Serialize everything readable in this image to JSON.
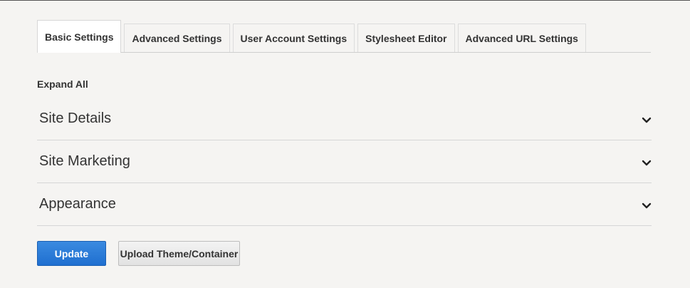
{
  "tabs": [
    {
      "label": "Basic Settings",
      "active": true
    },
    {
      "label": "Advanced Settings",
      "active": false
    },
    {
      "label": "User Account Settings",
      "active": false
    },
    {
      "label": "Stylesheet Editor",
      "active": false
    },
    {
      "label": "Advanced URL Settings",
      "active": false
    }
  ],
  "expand_all_label": "Expand All",
  "sections": [
    {
      "title": "Site Details",
      "icon": "chevron-down-icon"
    },
    {
      "title": "Site Marketing",
      "icon": "chevron-down-icon"
    },
    {
      "title": "Appearance",
      "icon": "chevron-down-icon"
    }
  ],
  "buttons": {
    "update_label": "Update",
    "upload_label": "Upload Theme/Container"
  },
  "colors": {
    "background": "#f5f4f2",
    "primary_button": "#2a7ad8",
    "text": "#333333"
  }
}
